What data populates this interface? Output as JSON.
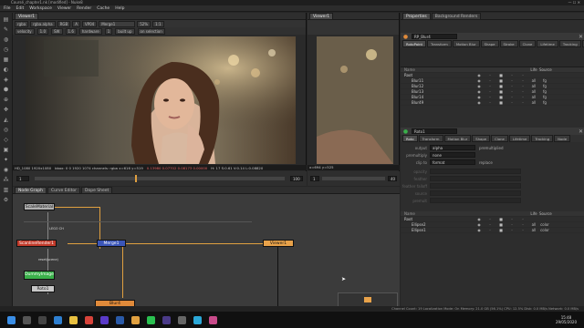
{
  "window": {
    "title": "Coursé_chapter1.nk [modified] - Nuke8",
    "menu": [
      "File",
      "Edit",
      "Workspace",
      "Viewer",
      "Render",
      "Cache",
      "Help"
    ]
  },
  "viewer1": {
    "tab": "Viewer1",
    "toolbar": {
      "channels": "rgba",
      "alpha": "rgba.alpha",
      "cs": "RGB",
      "ab": "A",
      "input": "VP04",
      "merge": "Merge1",
      "zoom": "52%",
      "ratio": "1:1",
      "fstop": "f/8",
      "gamma": "1",
      "gain": "1"
    },
    "sub": [
      "velocity",
      "1.0",
      "SW",
      "1.6",
      "hardware",
      "1",
      "built up",
      "on selection"
    ],
    "status": {
      "format": "HD_1080 1920x1080",
      "bbox": "bbox: 0 0 1920 1074 channels: rgba x=616 y=519",
      "rgba": "0.13980  0.07702  0.08173  0.00000",
      "hsv": "H: 17 S:0.61 V:0.14  L:0.08820"
    },
    "frame": "1",
    "range": "100"
  },
  "viewer2": {
    "tab": "Viewer1",
    "status": "x=694 y=525",
    "frame": "1",
    "range": "40"
  },
  "nodegraph": {
    "tabs": [
      "Node Graph",
      "Curve Editor",
      "Dope Sheet"
    ],
    "nodes": {
      "read": "ScaleMaterial",
      "scanline": "ScanlineRender1",
      "merge": "Merge1",
      "roto": "Roto1",
      "dummy": "DummyImage",
      "blur": "Blur4",
      "viewer": "Viewer1"
    },
    "labels": [
      "LEGO CH",
      "reset(scene)"
    ]
  },
  "properties": {
    "tabs": [
      "Properties",
      "Background Renders"
    ],
    "node_name": "RP_Blur4",
    "subtabs": [
      "RotoPaint",
      "Transform",
      "Motion Blur",
      "Shape",
      "Stroke",
      "Clone",
      "Lifetime",
      "Tracking",
      "Node"
    ],
    "columns": [
      "Name",
      "",
      "",
      "",
      "",
      "",
      "Life",
      "Source"
    ],
    "layers": [
      {
        "name": "Root",
        "life": "",
        "src": ""
      },
      {
        "name": "Blur11",
        "life": "all",
        "src": "fg"
      },
      {
        "name": "Blur12",
        "life": "all",
        "src": "fg"
      },
      {
        "name": "Blur13",
        "life": "all",
        "src": "fg"
      },
      {
        "name": "Blur14",
        "life": "all",
        "src": "fg"
      },
      {
        "name": "Blur49",
        "life": "all",
        "src": "fg"
      }
    ]
  },
  "roto": {
    "node_name": "Roto1",
    "subtabs": [
      "Roto",
      "Transform",
      "Motion Blur",
      "Shape",
      "Clone",
      "Lifetime",
      "Tracking",
      "Node"
    ],
    "props": [
      {
        "label": "output",
        "value": "alpha",
        "extra": "premultiplied"
      },
      {
        "label": "premultiply",
        "value": "none",
        "extra": ""
      },
      {
        "label": "clip to",
        "value": "format",
        "extra": "replace"
      }
    ],
    "faded": [
      "opacity",
      "feather",
      "feather falloff",
      "source",
      "premult"
    ],
    "columns": [
      "Name",
      "",
      "",
      "",
      "",
      "",
      "Life",
      "Source"
    ],
    "layers": [
      {
        "name": "Root",
        "life": "",
        "src": ""
      },
      {
        "name": "Ellipse2",
        "life": "all",
        "src": "color"
      },
      {
        "name": "Ellipse1",
        "life": "all",
        "src": "color"
      }
    ]
  },
  "statusbar": "Channel Count: 19  Localization Mode: On  Memory: 21.0 GB (56.1%)  CPU: 12.5%  Disk: 0.0 MB/s  Network: 0.0 MB/s",
  "taskbar": {
    "clock": "15:48",
    "date": "29/05/2020"
  }
}
